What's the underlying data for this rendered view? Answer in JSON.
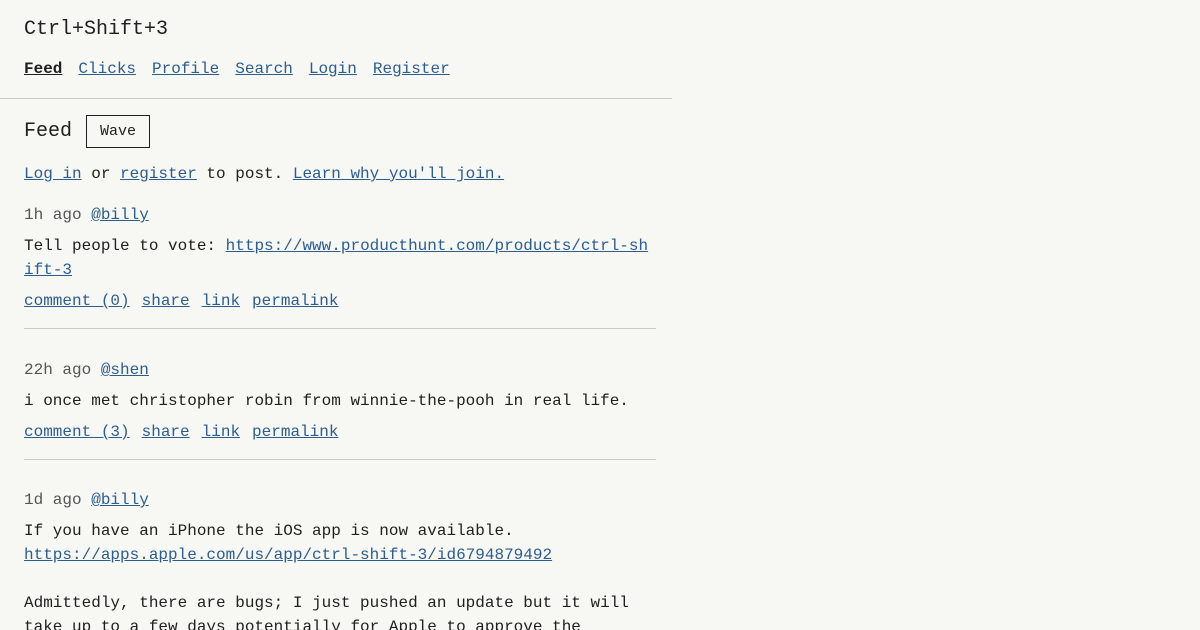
{
  "site": {
    "title": "Ctrl+Shift+3"
  },
  "nav": {
    "feed": "Feed",
    "clicks": "Clicks",
    "profile": "Profile",
    "search": "Search",
    "login": "Login",
    "register": "Register"
  },
  "feed": {
    "title": "Feed",
    "wave_label": "Wave"
  },
  "notice": {
    "login_link": "Log in",
    "or": " or ",
    "register_link": "register",
    "to_post": " to post. ",
    "learn_link": "Learn why you'll join."
  },
  "posts": [
    {
      "time": "1h ago",
      "author": "@billy",
      "text": "Tell people to vote: ",
      "link": "https://www.producthunt.com/products/ctrl-shift-3",
      "comment_label": "comment (0)",
      "share_label": "share",
      "link_label": "link",
      "permalink_label": "permalink"
    },
    {
      "time": "22h ago",
      "author": "@shen",
      "text": "i once met christopher robin from winnie-the-pooh in real life.",
      "comment_label": "comment (3)",
      "share_label": "share",
      "link_label": "link",
      "permalink_label": "permalink"
    },
    {
      "time": "1d ago",
      "author": "@billy",
      "text_line1": "If you have an iPhone the iOS app is now available.",
      "link": "https://apps.apple.com/us/app/ctrl-shift-3/id6794879492",
      "text_line2": "Admittedly, there are bugs; I just pushed an update but it will take up to a few days potentially for Apple to approve the"
    }
  ]
}
